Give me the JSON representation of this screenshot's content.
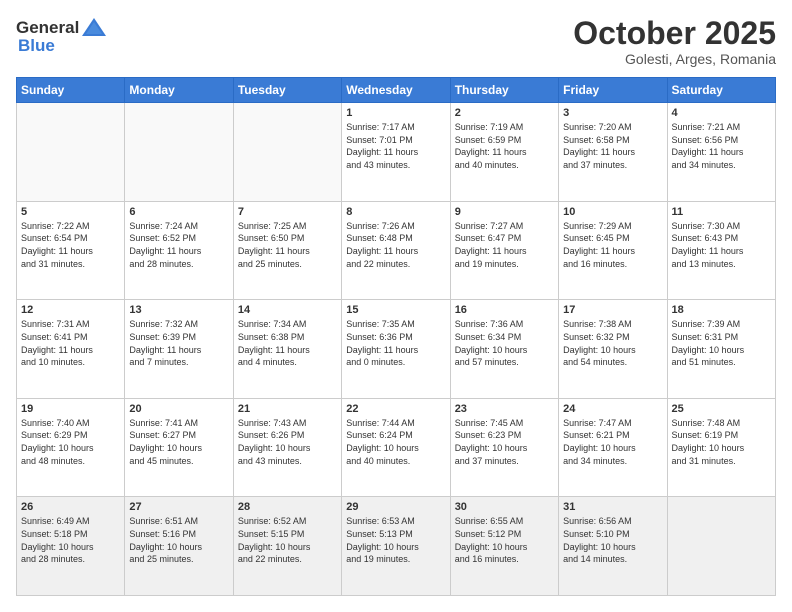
{
  "header": {
    "logo_general": "General",
    "logo_blue": "Blue",
    "month": "October 2025",
    "location": "Golesti, Arges, Romania"
  },
  "weekdays": [
    "Sunday",
    "Monday",
    "Tuesday",
    "Wednesday",
    "Thursday",
    "Friday",
    "Saturday"
  ],
  "weeks": [
    [
      {
        "day": "",
        "info": ""
      },
      {
        "day": "",
        "info": ""
      },
      {
        "day": "",
        "info": ""
      },
      {
        "day": "1",
        "info": "Sunrise: 7:17 AM\nSunset: 7:01 PM\nDaylight: 11 hours\nand 43 minutes."
      },
      {
        "day": "2",
        "info": "Sunrise: 7:19 AM\nSunset: 6:59 PM\nDaylight: 11 hours\nand 40 minutes."
      },
      {
        "day": "3",
        "info": "Sunrise: 7:20 AM\nSunset: 6:58 PM\nDaylight: 11 hours\nand 37 minutes."
      },
      {
        "day": "4",
        "info": "Sunrise: 7:21 AM\nSunset: 6:56 PM\nDaylight: 11 hours\nand 34 minutes."
      }
    ],
    [
      {
        "day": "5",
        "info": "Sunrise: 7:22 AM\nSunset: 6:54 PM\nDaylight: 11 hours\nand 31 minutes."
      },
      {
        "day": "6",
        "info": "Sunrise: 7:24 AM\nSunset: 6:52 PM\nDaylight: 11 hours\nand 28 minutes."
      },
      {
        "day": "7",
        "info": "Sunrise: 7:25 AM\nSunset: 6:50 PM\nDaylight: 11 hours\nand 25 minutes."
      },
      {
        "day": "8",
        "info": "Sunrise: 7:26 AM\nSunset: 6:48 PM\nDaylight: 11 hours\nand 22 minutes."
      },
      {
        "day": "9",
        "info": "Sunrise: 7:27 AM\nSunset: 6:47 PM\nDaylight: 11 hours\nand 19 minutes."
      },
      {
        "day": "10",
        "info": "Sunrise: 7:29 AM\nSunset: 6:45 PM\nDaylight: 11 hours\nand 16 minutes."
      },
      {
        "day": "11",
        "info": "Sunrise: 7:30 AM\nSunset: 6:43 PM\nDaylight: 11 hours\nand 13 minutes."
      }
    ],
    [
      {
        "day": "12",
        "info": "Sunrise: 7:31 AM\nSunset: 6:41 PM\nDaylight: 11 hours\nand 10 minutes."
      },
      {
        "day": "13",
        "info": "Sunrise: 7:32 AM\nSunset: 6:39 PM\nDaylight: 11 hours\nand 7 minutes."
      },
      {
        "day": "14",
        "info": "Sunrise: 7:34 AM\nSunset: 6:38 PM\nDaylight: 11 hours\nand 4 minutes."
      },
      {
        "day": "15",
        "info": "Sunrise: 7:35 AM\nSunset: 6:36 PM\nDaylight: 11 hours\nand 0 minutes."
      },
      {
        "day": "16",
        "info": "Sunrise: 7:36 AM\nSunset: 6:34 PM\nDaylight: 10 hours\nand 57 minutes."
      },
      {
        "day": "17",
        "info": "Sunrise: 7:38 AM\nSunset: 6:32 PM\nDaylight: 10 hours\nand 54 minutes."
      },
      {
        "day": "18",
        "info": "Sunrise: 7:39 AM\nSunset: 6:31 PM\nDaylight: 10 hours\nand 51 minutes."
      }
    ],
    [
      {
        "day": "19",
        "info": "Sunrise: 7:40 AM\nSunset: 6:29 PM\nDaylight: 10 hours\nand 48 minutes."
      },
      {
        "day": "20",
        "info": "Sunrise: 7:41 AM\nSunset: 6:27 PM\nDaylight: 10 hours\nand 45 minutes."
      },
      {
        "day": "21",
        "info": "Sunrise: 7:43 AM\nSunset: 6:26 PM\nDaylight: 10 hours\nand 43 minutes."
      },
      {
        "day": "22",
        "info": "Sunrise: 7:44 AM\nSunset: 6:24 PM\nDaylight: 10 hours\nand 40 minutes."
      },
      {
        "day": "23",
        "info": "Sunrise: 7:45 AM\nSunset: 6:23 PM\nDaylight: 10 hours\nand 37 minutes."
      },
      {
        "day": "24",
        "info": "Sunrise: 7:47 AM\nSunset: 6:21 PM\nDaylight: 10 hours\nand 34 minutes."
      },
      {
        "day": "25",
        "info": "Sunrise: 7:48 AM\nSunset: 6:19 PM\nDaylight: 10 hours\nand 31 minutes."
      }
    ],
    [
      {
        "day": "26",
        "info": "Sunrise: 6:49 AM\nSunset: 5:18 PM\nDaylight: 10 hours\nand 28 minutes."
      },
      {
        "day": "27",
        "info": "Sunrise: 6:51 AM\nSunset: 5:16 PM\nDaylight: 10 hours\nand 25 minutes."
      },
      {
        "day": "28",
        "info": "Sunrise: 6:52 AM\nSunset: 5:15 PM\nDaylight: 10 hours\nand 22 minutes."
      },
      {
        "day": "29",
        "info": "Sunrise: 6:53 AM\nSunset: 5:13 PM\nDaylight: 10 hours\nand 19 minutes."
      },
      {
        "day": "30",
        "info": "Sunrise: 6:55 AM\nSunset: 5:12 PM\nDaylight: 10 hours\nand 16 minutes."
      },
      {
        "day": "31",
        "info": "Sunrise: 6:56 AM\nSunset: 5:10 PM\nDaylight: 10 hours\nand 14 minutes."
      },
      {
        "day": "",
        "info": ""
      }
    ]
  ]
}
